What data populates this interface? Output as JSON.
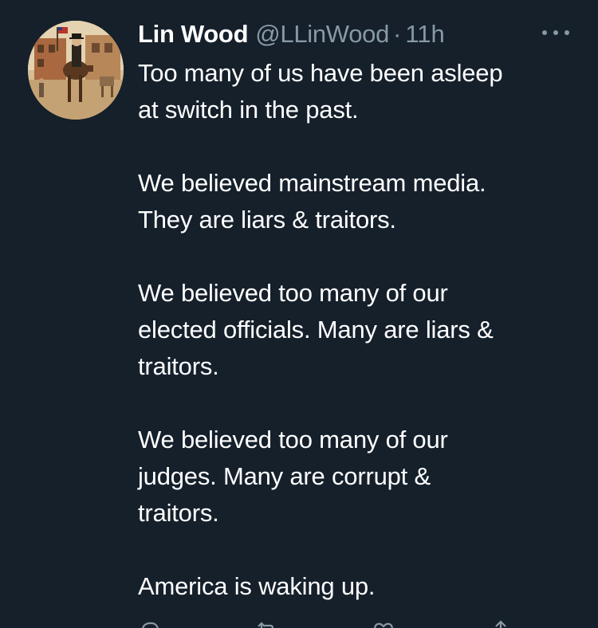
{
  "tweet": {
    "author": {
      "display_name": "Lin Wood",
      "handle": "@LLinWood",
      "separator": "·",
      "time": "11h",
      "avatar_icon": "profile-avatar"
    },
    "more_icon": "more-options-icon",
    "body_paragraphs": [
      "Too many of us have been asleep\nat switch in the past.",
      "We believed mainstream media.\nThey are liars & traitors.",
      "We believed too many of our\nelected officials. Many are liars &\ntraitors.",
      "We believed too many of our\njudges. Many are corrupt &\ntraitors.",
      "America is waking up."
    ],
    "actions": [
      {
        "name": "reply-icon"
      },
      {
        "name": "retweet-icon"
      },
      {
        "name": "like-icon"
      },
      {
        "name": "share-icon"
      }
    ]
  },
  "colors": {
    "background": "#15202b",
    "text": "#ffffff",
    "secondary_text": "#8899a6"
  }
}
